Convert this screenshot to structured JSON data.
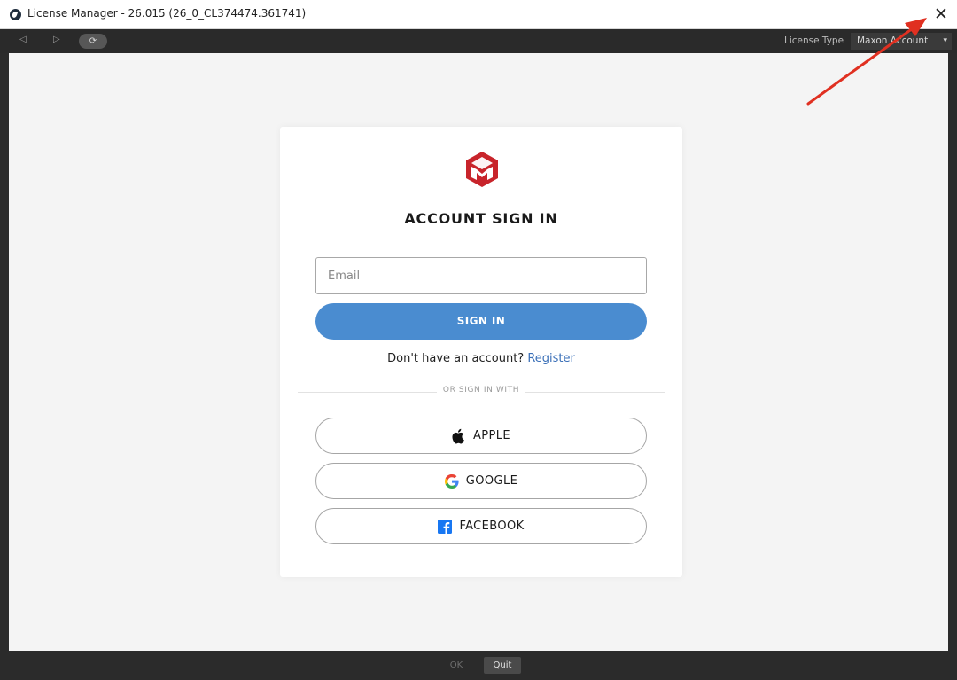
{
  "window": {
    "title": "License Manager - 26.015 (26_0_CL374474.361741)",
    "close_symbol": "✕"
  },
  "toolbar": {
    "back_icon": "◁",
    "forward_icon": "▷",
    "refresh_label": "⟳",
    "license_type_label": "License Type",
    "license_type_value": "Maxon Account",
    "dropdown_icon": "▾"
  },
  "signin": {
    "logo": "maxon-logo",
    "brand_color": "#c8242b",
    "title": "ACCOUNT SIGN IN",
    "email_placeholder": "Email",
    "email_value": "",
    "signin_button": "SIGN IN",
    "signin_color": "#4a8cd0",
    "no_account_text": "Don't have an account?",
    "register_link": "Register",
    "divider_text": "OR SIGN IN WITH",
    "social": [
      {
        "label": "APPLE",
        "icon": "apple-icon"
      },
      {
        "label": "GOOGLE",
        "icon": "google-icon"
      },
      {
        "label": "FACEBOOK",
        "icon": "facebook-icon"
      }
    ]
  },
  "footer": {
    "ok_label": "OK",
    "quit_label": "Quit"
  }
}
